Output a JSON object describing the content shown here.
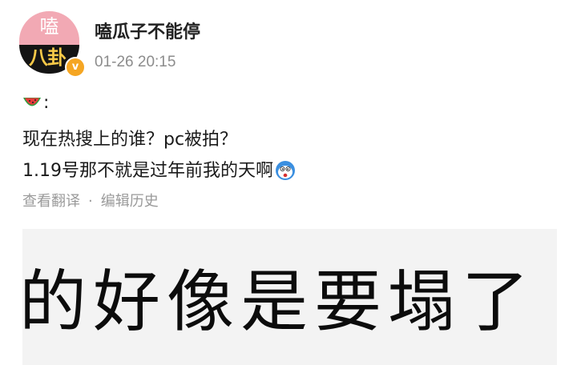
{
  "post": {
    "author": {
      "name": "嗑瓜子不能停",
      "avatar_top_text": "嗑",
      "avatar_bottom_text": "八卦",
      "badge_symbol": "v",
      "badge_color": "#f5a623"
    },
    "timestamp": "01-26 20:15",
    "emoji_line": {
      "icon": "watermelon-icon",
      "suffix": ":"
    },
    "lines": [
      "现在热搜上的谁？pc被拍？",
      "1.19号那不就是过年前我的天啊"
    ],
    "line_end_icon": "surprised-face-icon",
    "meta": {
      "translate_label": "查看翻译",
      "separator": "·",
      "edit_history_label": "编辑历史"
    },
    "image": {
      "text": "的好像是要塌了",
      "background": "#f3f3f3"
    }
  },
  "colors": {
    "avatar_pink": "#f2a9b4",
    "avatar_dark": "#141414",
    "avatar_gold": "#f7c948",
    "meta_gray": "#9a9a9a",
    "timestamp_gray": "#8c8c8c"
  }
}
